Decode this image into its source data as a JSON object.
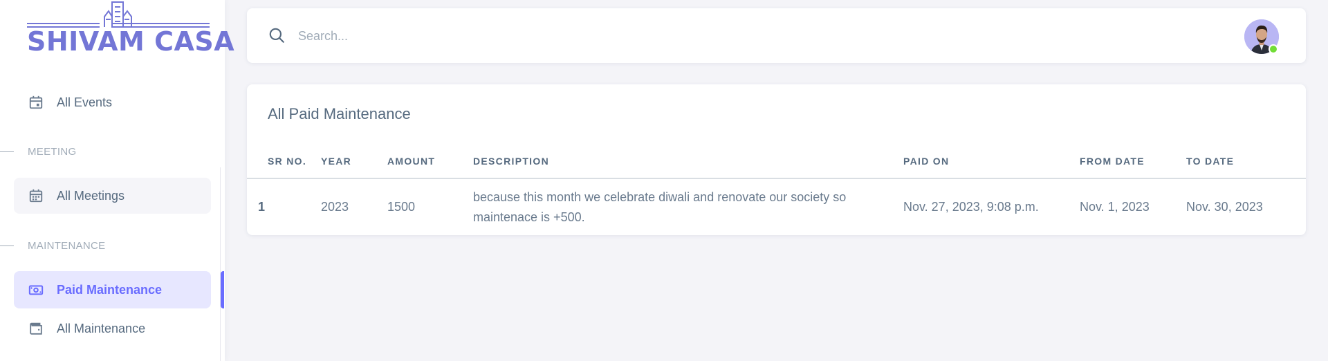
{
  "brand": {
    "name": "SHIVAM CASA",
    "color": "#7376d6"
  },
  "sidebar": {
    "items": [
      {
        "label": "All Events",
        "icon": "calendar-icon"
      },
      {
        "label": "All Meetings",
        "icon": "calendar-grid-icon"
      },
      {
        "label": "Paid Maintenance",
        "icon": "cash-icon",
        "active": true
      },
      {
        "label": "All Maintenance",
        "icon": "wallet-icon"
      }
    ],
    "headers": {
      "meeting": "MEETING",
      "maintenance": "MAINTENANCE"
    }
  },
  "search": {
    "placeholder": "Search..."
  },
  "user": {
    "avatar": "user-avatar",
    "status": "online",
    "status_color": "#71dd37"
  },
  "card": {
    "title": "All Paid Maintenance",
    "columns": [
      "SR NO.",
      "YEAR",
      "AMOUNT",
      "DESCRIPTION",
      "PAID ON",
      "FROM DATE",
      "TO DATE"
    ],
    "rows": [
      {
        "sr": "1",
        "year": "2023",
        "amount": "1500",
        "description": "because this month we celebrate diwali and renovate our society so maintenace is +500.",
        "paid_on": "Nov. 27, 2023, 9:08 p.m.",
        "from_date": "Nov. 1, 2023",
        "to_date": "Nov. 30, 2023"
      }
    ]
  },
  "colors": {
    "accent": "#696cff",
    "accent_bg": "#e7e7ff",
    "page_bg": "#f4f4f8"
  }
}
